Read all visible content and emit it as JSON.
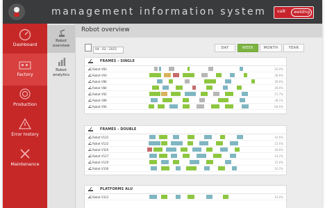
{
  "app": {
    "title": "management information system",
    "brand_left": "valk",
    "brand_right": "welding"
  },
  "sidebar": {
    "items": [
      {
        "label": "Dashboard",
        "icon": "gauge-icon",
        "active": false
      },
      {
        "label": "Factory",
        "icon": "factory-icon",
        "active": true
      },
      {
        "label": "Production",
        "icon": "target-icon",
        "active": false
      },
      {
        "label": "Error history",
        "icon": "warning-icon",
        "active": false
      },
      {
        "label": "Maintenance",
        "icon": "wrench-icon",
        "active": false
      }
    ]
  },
  "subnav": {
    "items": [
      {
        "label": "Robot overview",
        "icon": "robot-arm-icon",
        "active": true
      },
      {
        "label": "Robot analytics",
        "icon": "bar-chart-icon",
        "active": false
      }
    ]
  },
  "main": {
    "title": "Robot overview",
    "date": "04 - 03 - 2015",
    "periods": [
      {
        "label": "DAY",
        "active": false
      },
      {
        "label": "WEEK",
        "active": true
      },
      {
        "label": "MONTH",
        "active": false
      },
      {
        "label": "YEAR",
        "active": false
      }
    ]
  },
  "colors": {
    "running": "#8dc63f",
    "pause": "#b6b6b6",
    "error": "#c56b6b",
    "idle": "#7fb6c2",
    "warning": "#d8b25a"
  },
  "panels": [
    {
      "title": "FRAMES - SINGLE",
      "rows": [
        {
          "name": "Robot V83",
          "pct": "20.0%",
          "pattern": "A"
        },
        {
          "name": "Robot V93",
          "pct": "38.6%",
          "pattern": "B"
        },
        {
          "name": "Robot V86",
          "pct": "38.6%",
          "pattern": "C"
        },
        {
          "name": "Robot V84",
          "pct": "38.6%",
          "pattern": "D"
        },
        {
          "name": "Robot V92",
          "pct": "51.7%",
          "pattern": "E"
        },
        {
          "name": "Robot V89",
          "pct": "38.1%",
          "pattern": "F"
        },
        {
          "name": "Robot V94",
          "pct": "68.6%",
          "pattern": "G"
        }
      ]
    },
    {
      "title": "FRAMES - DOUBLE",
      "rows": [
        {
          "name": "Robot V131",
          "pct": "32.6%",
          "pattern": "H"
        },
        {
          "name": "Robot V122",
          "pct": "22.6%",
          "pattern": "I"
        },
        {
          "name": "Robot V320",
          "pct": "28.6%",
          "pattern": "J"
        },
        {
          "name": "Robot V127",
          "pct": "34.2%",
          "pattern": "K"
        },
        {
          "name": "Robot V129",
          "pct": "25.6%",
          "pattern": "L"
        },
        {
          "name": "Robot V336",
          "pct": "30.2%",
          "pattern": "M"
        }
      ]
    },
    {
      "title": "PLATFORMS ALU",
      "rows": [
        {
          "name": "Robot V312",
          "pct": "33.6%",
          "pattern": "N"
        }
      ]
    }
  ]
}
